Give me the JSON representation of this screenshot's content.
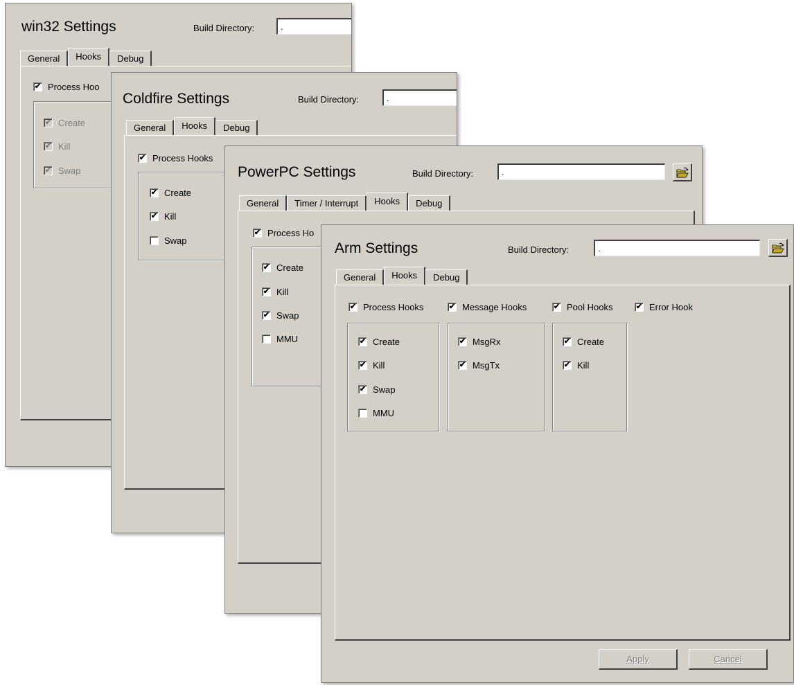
{
  "folder_icon": "open-folder-icon",
  "check_glyph": "✔",
  "panels": {
    "win32": {
      "title": "win32 Settings",
      "build_dir_label": "Build Directory:",
      "build_dir_value": ".",
      "tabs": [
        "General",
        "Hooks",
        "Debug"
      ],
      "process_hooks": "Process Hoo",
      "items": [
        "Create",
        "Kill",
        "Swap"
      ]
    },
    "coldfire": {
      "title": "Coldfire Settings",
      "build_dir_label": "Build Directory:",
      "build_dir_value": ".",
      "tabs": [
        "General",
        "Hooks",
        "Debug"
      ],
      "process_hooks": "Process Hooks",
      "items": [
        "Create",
        "Kill",
        "Swap"
      ]
    },
    "powerpc": {
      "title": "PowerPC Settings",
      "build_dir_label": "Build Directory:",
      "build_dir_value": ".",
      "tabs": [
        "General",
        "Timer / Interrupt",
        "Hooks",
        "Debug"
      ],
      "process_hooks": "Process Ho",
      "items": [
        "Create",
        "Kill",
        "Swap",
        "MMU"
      ]
    },
    "arm": {
      "title": "Arm Settings",
      "build_dir_label": "Build Directory:",
      "build_dir_value": ".",
      "tabs": [
        "General",
        "Hooks",
        "Debug"
      ],
      "groups": {
        "process": {
          "label": "Process Hooks",
          "items": [
            "Create",
            "Kill",
            "Swap",
            "MMU"
          ]
        },
        "message": {
          "label": "Message Hooks",
          "items": [
            "MsgRx",
            "MsgTx"
          ]
        },
        "pool": {
          "label": "Pool Hooks",
          "items": [
            "Create",
            "Kill"
          ]
        },
        "error": {
          "label": "Error Hook"
        }
      },
      "apply_label": "Apply",
      "cancel_label": "Cancel"
    }
  }
}
